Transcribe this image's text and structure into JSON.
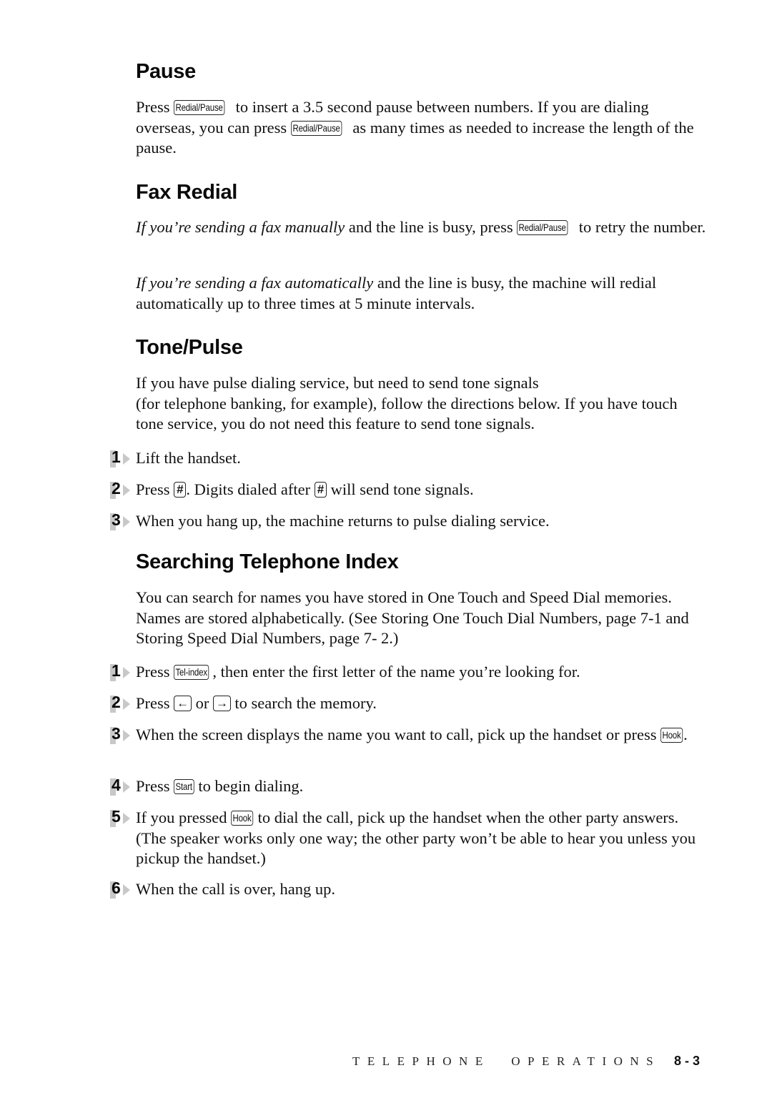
{
  "sections": {
    "pause": {
      "heading": "Pause",
      "p1": {
        "t1": "Press ",
        "key1": "Redial/Pause",
        "t2": " to insert a 3.5 second pause between numbers. If you are dialing overseas, you can press ",
        "key2": "Redial/Pause",
        "t3": " as many times as needed to increase the length of the pause."
      }
    },
    "fax_redial": {
      "heading": "Fax Redial",
      "p1": {
        "em": "If you’re sending a fax manually",
        "t1": " and the line is busy, press ",
        "key": "Redial/Pause",
        "t2": " to retry the number."
      },
      "p2": {
        "em": "If you’re sending a fax automatically",
        "t1": " and the line is busy, the machine will redial automatically up to three times at 5 minute intervals."
      }
    },
    "tone_pulse": {
      "heading": "Tone/Pulse",
      "intro_line1": "If you have pulse dialing service, but need to send tone signals",
      "intro_line2": "(for telephone banking, for example), follow the directions below. If you have touch tone service, you do not need this feature to send tone signals.",
      "steps": [
        {
          "num": "1",
          "t1": "Lift the handset."
        },
        {
          "num": "2",
          "t1": "Press ",
          "key1": "#",
          "t2": ". Digits dialed after ",
          "key2": "#",
          "t3": " will send tone signals."
        },
        {
          "num": "3",
          "t1": "When you hang up, the machine returns to pulse dialing service."
        }
      ]
    },
    "searching": {
      "heading": "Searching Telephone Index",
      "intro": "You can search for names you have stored in One Touch and Speed Dial memories. Names are stored alphabetically. (See Storing One Touch Dial Numbers, page 7-1 and Storing Speed Dial Numbers, page 7- 2.)",
      "steps": [
        {
          "num": "1",
          "t1": "Press ",
          "key1": "Tel-index",
          "t2": ", then enter the first letter of the name you’re looking for."
        },
        {
          "num": "2",
          "t1": "Press ",
          "key1": "←",
          "t2": " or ",
          "key2": "→",
          "t3": " to search the memory."
        },
        {
          "num": "3",
          "t1": "When the screen displays the name you want to call, pick up the handset or press ",
          "key1": "Hook",
          "t2": "."
        },
        {
          "num": "4",
          "t1": "Press ",
          "key1": "Start",
          "t2": " to begin dialing."
        },
        {
          "num": "5",
          "t1": "If you pressed ",
          "key1": "Hook",
          "t2": " to dial the call, pick up the handset when the other party answers. (The speaker works only one way; the other party won’t be able to hear you unless you pickup the handset.)"
        },
        {
          "num": "6",
          "t1": "When the call is over, hang up."
        }
      ]
    }
  },
  "footer": {
    "chapter": "TELEPHONE  OPERATIONS",
    "page": "8 - 3"
  }
}
